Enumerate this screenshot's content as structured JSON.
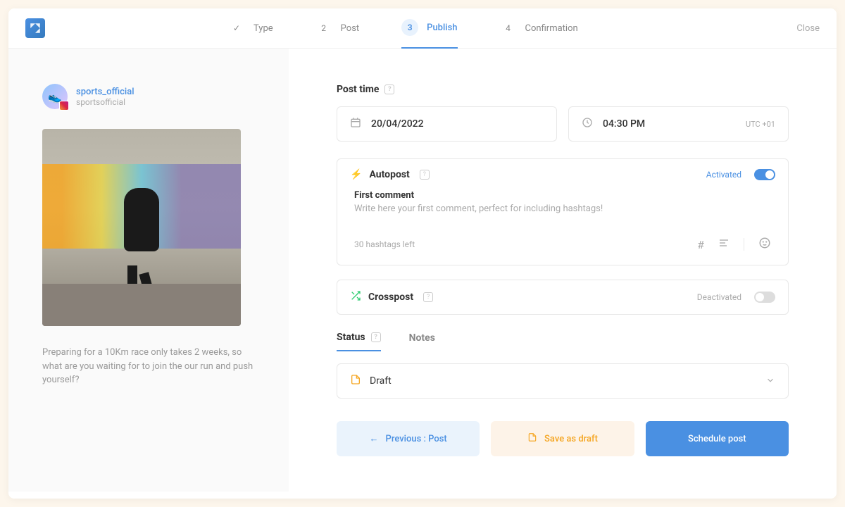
{
  "header": {
    "close": "Close",
    "steps": [
      {
        "num": "✓",
        "label": "Type"
      },
      {
        "num": "2",
        "label": "Post"
      },
      {
        "num": "3",
        "label": "Publish"
      },
      {
        "num": "4",
        "label": "Confirmation"
      }
    ]
  },
  "sidebar": {
    "account_name": "sports_official",
    "account_handle": "sportsofficial",
    "caption": "Preparing for a 10Km race only takes 2 weeks, so what are you waiting for to join the our run and push yourself?"
  },
  "main": {
    "post_time_label": "Post time",
    "date": "20/04/2022",
    "time": "04:30 PM",
    "timezone": "UTC +01",
    "autopost": {
      "title": "Autopost",
      "status": "Activated",
      "first_comment_label": "First comment",
      "first_comment_placeholder": "Write here your first comment, perfect for including hashtags!",
      "hashtag_count": "30 hashtags left"
    },
    "crosspost": {
      "title": "Crosspost",
      "status": "Deactivated"
    },
    "tabs": {
      "status": "Status",
      "notes": "Notes"
    },
    "status_value": "Draft",
    "actions": {
      "previous": "Previous : Post",
      "save_draft": "Save as draft",
      "schedule": "Schedule post"
    }
  }
}
